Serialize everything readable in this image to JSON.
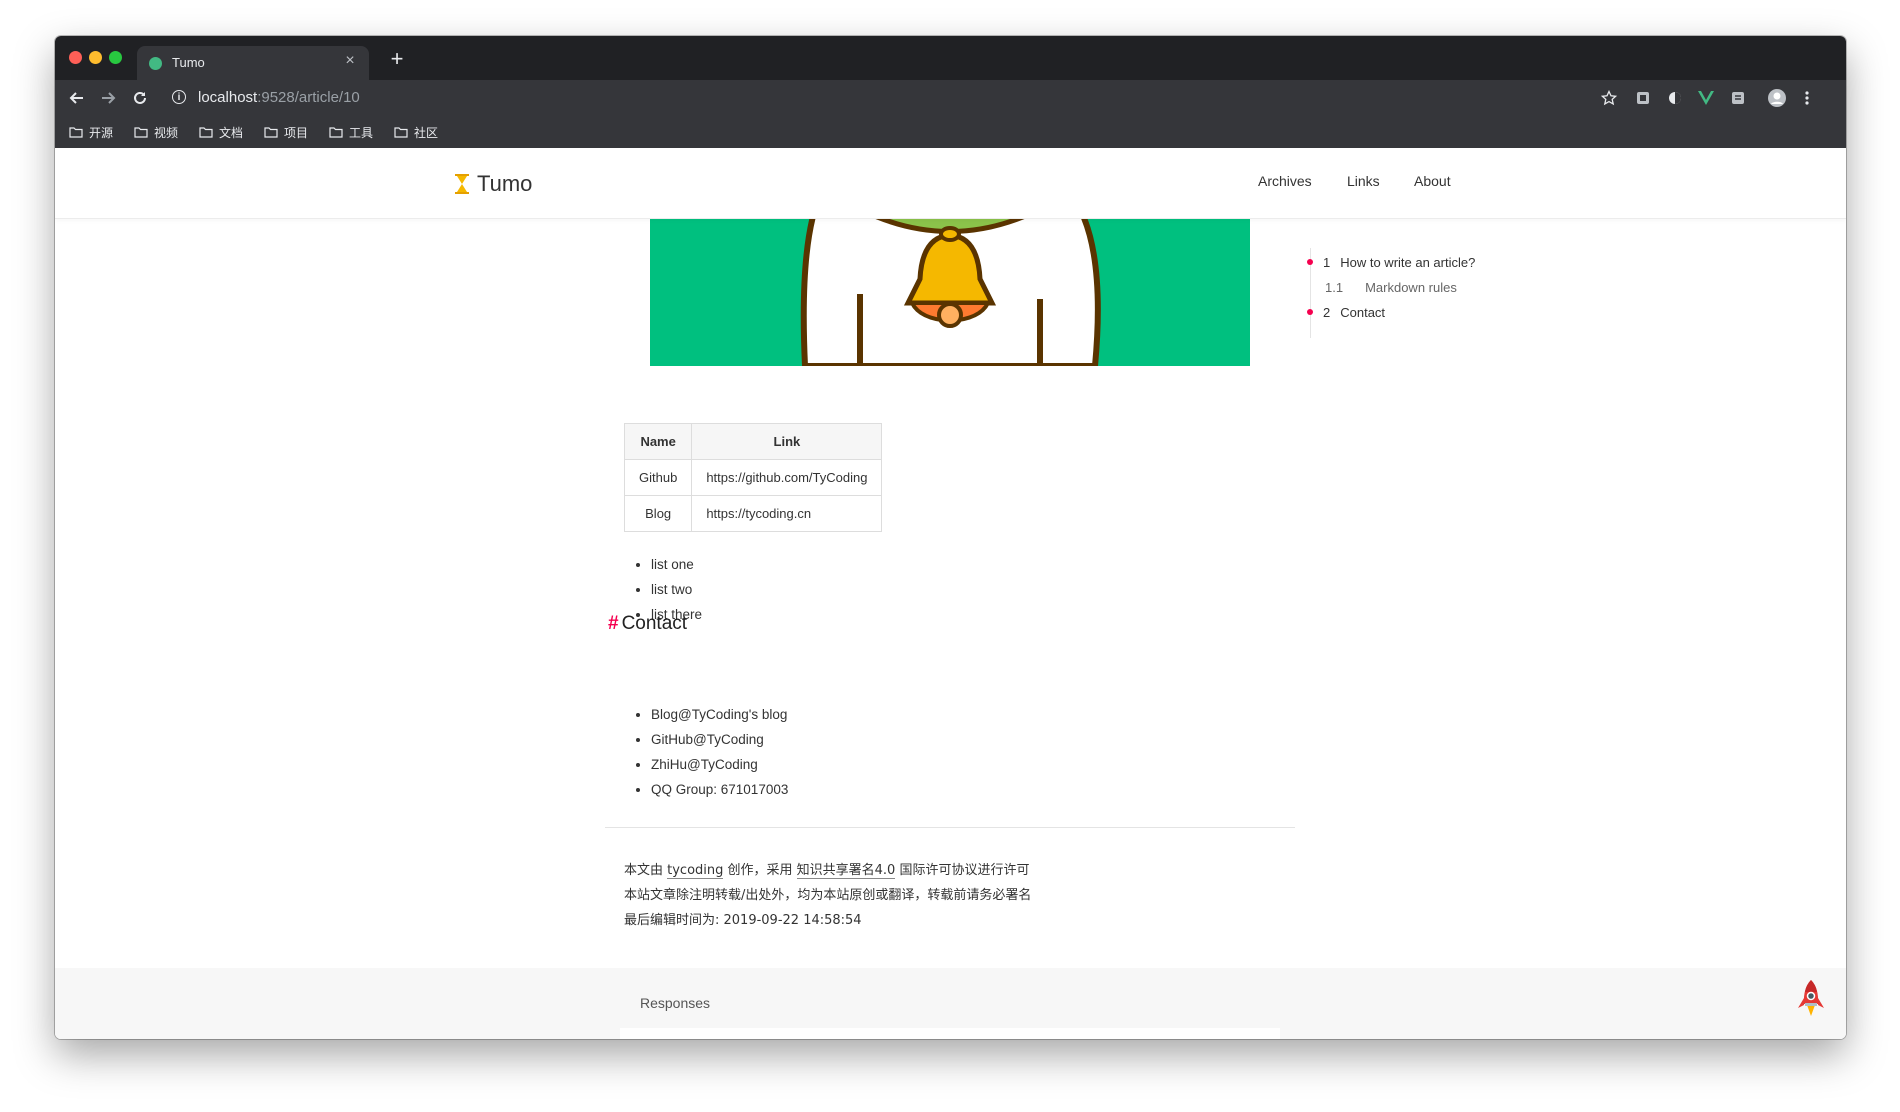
{
  "browser": {
    "tab": {
      "title": "Tumo",
      "close_label": "×"
    },
    "new_tab_label": "+",
    "address": {
      "host": "localhost",
      "path": ":9528/article/10"
    },
    "bookmarks": [
      "开源",
      "视频",
      "文档",
      "项目",
      "工具",
      "社区"
    ]
  },
  "site": {
    "logo_text": "Tumo",
    "nav": [
      "Archives",
      "Links",
      "About"
    ]
  },
  "toc": {
    "items": [
      {
        "num": "1",
        "label": "How to write an article?"
      },
      {
        "num": "1.1",
        "label": "Markdown rules"
      },
      {
        "num": "2",
        "label": "Contact"
      }
    ]
  },
  "article": {
    "table": {
      "headers": [
        "Name",
        "Link"
      ],
      "rows": [
        [
          "Github",
          "https://github.com/TyCoding"
        ],
        [
          "Blog",
          "https://tycoding.cn"
        ]
      ]
    },
    "list1": [
      "list one",
      "list two",
      "list there"
    ],
    "contact_heading_hash": "#",
    "contact_heading": "Contact",
    "contact_list": [
      "Blog@TyCoding's blog",
      "GitHub@TyCoding",
      "ZhiHu@TyCoding",
      "QQ Group: 671017003"
    ],
    "license": {
      "line1_prefix": "本文由 ",
      "author": "tycoding",
      "line1_mid": " 创作，采用 ",
      "license_name": "知识共享署名4.0",
      "line1_suffix": " 国际许可协议进行许可",
      "line2": "本站文章除注明转载/出处外，均为本站原创或翻译，转载前请务必署名",
      "line3": "最后编辑时间为: 2019-09-22 14:58:54"
    }
  },
  "responses": {
    "title": "Responses"
  },
  "colors": {
    "accent": "#f5004f",
    "hero_bg": "#00c07f",
    "browser_dark": "#202124",
    "browser_toolbar": "#35363a"
  }
}
